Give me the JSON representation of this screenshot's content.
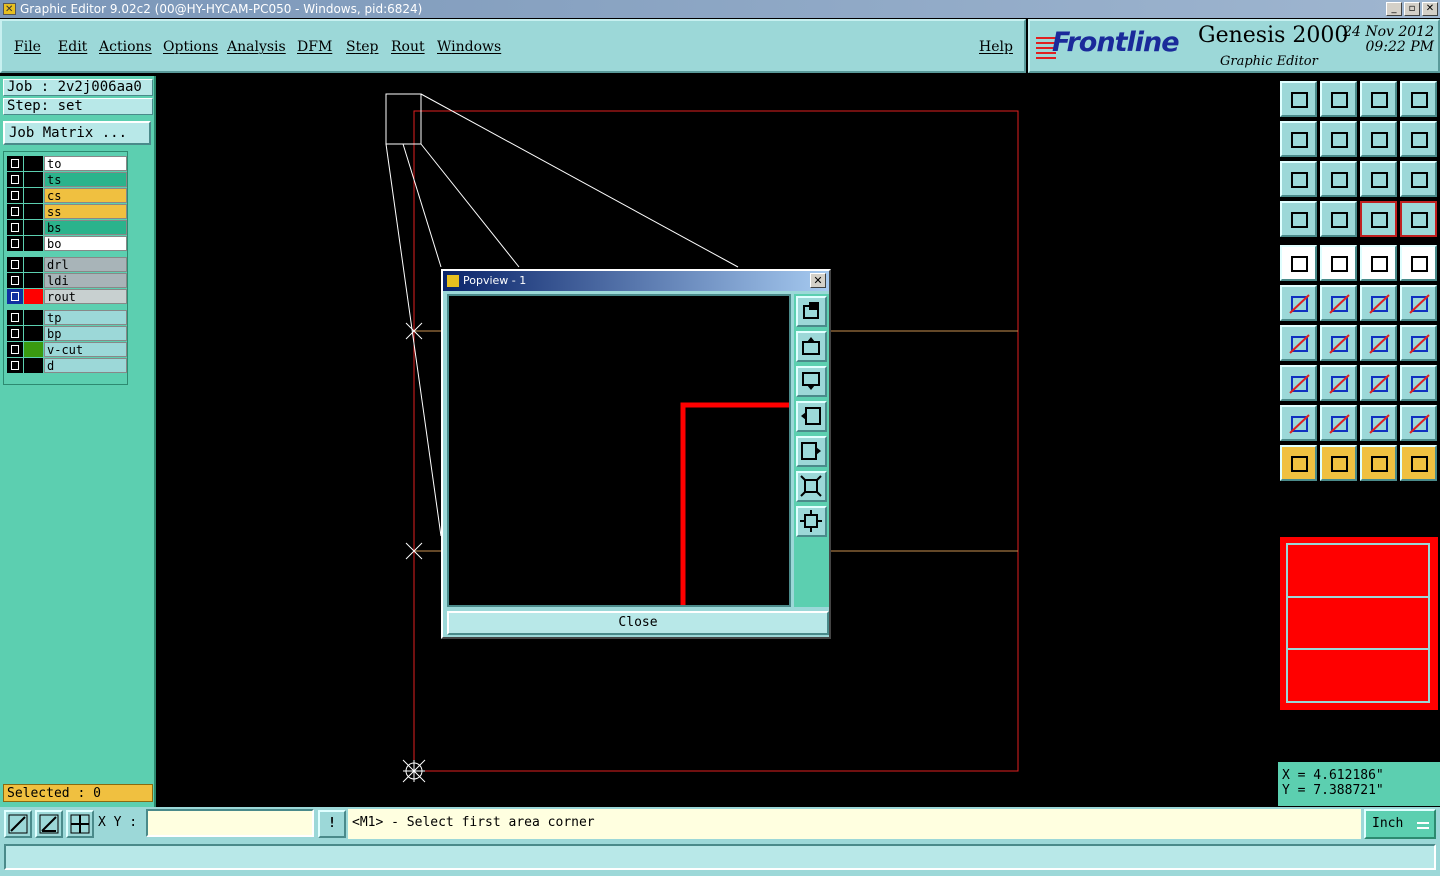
{
  "window": {
    "title": "Graphic Editor 9.02c2 (00@HY-HYCAM-PC050 - Windows, pid:6824)",
    "controls": [
      "_",
      "▫",
      "✕"
    ]
  },
  "menu": [
    {
      "label": "File"
    },
    {
      "label": "Edit"
    },
    {
      "label": "Actions"
    },
    {
      "label": "Options"
    },
    {
      "label": "Analysis"
    },
    {
      "label": "DFM"
    },
    {
      "label": "Step"
    },
    {
      "label": "Rout"
    },
    {
      "label": "Windows"
    }
  ],
  "help_label": "Help",
  "brand": {
    "logo": "Frontline",
    "product": "Genesis 2000",
    "subtitle": "Graphic Editor",
    "date": "24 Nov 2012",
    "time": "09:22 PM"
  },
  "left": {
    "job": "Job : 2v2j006aa0",
    "step": "Step: set",
    "job_matrix": "Job Matrix ...",
    "selected": "Selected : 0"
  },
  "layers": [
    {
      "name": "to",
      "color": "#ffffff",
      "swatch": "#000000"
    },
    {
      "name": "ts",
      "color": "#2bb38c",
      "swatch": "#000000"
    },
    {
      "name": "cs",
      "color": "#f0c040",
      "swatch": "#000000"
    },
    {
      "name": "ss",
      "color": "#f0c040",
      "swatch": "#000000"
    },
    {
      "name": "bs",
      "color": "#2bb38c",
      "swatch": "#000000"
    },
    {
      "name": "bo",
      "color": "#ffffff",
      "swatch": "#000000"
    },
    {
      "name": "drl",
      "color": "#a8b4b8",
      "swatch": "#000000"
    },
    {
      "name": "ldi",
      "color": "#a8b4b8",
      "swatch": "#000000"
    },
    {
      "name": "rout",
      "color": "#c8d0d0",
      "swatch": "#ff0000",
      "active": true
    },
    {
      "name": "tp",
      "color": "#9cd8d8",
      "swatch": "#000000"
    },
    {
      "name": "bp",
      "color": "#9cd8d8",
      "swatch": "#000000"
    },
    {
      "name": "v-cut",
      "color": "#9cd8d8",
      "swatch": "#3a9a10"
    },
    {
      "name": "d",
      "color": "#9cd8d8",
      "swatch": "#000000"
    }
  ],
  "popview": {
    "title": "Popview - 1",
    "close_label": "Close"
  },
  "coords": {
    "x": "X = 4.612186\"",
    "y": "Y = 7.388721\""
  },
  "command": {
    "xy_label": "X Y :",
    "xy_value": "",
    "bang": "!",
    "prompt": "<M1> - Select first area corner",
    "units": "Inch"
  },
  "colors": {
    "panel": "#9cd8d8",
    "accent": "#5ccfb0",
    "rout": "#ff0000",
    "profile": "#c0c0c0"
  }
}
